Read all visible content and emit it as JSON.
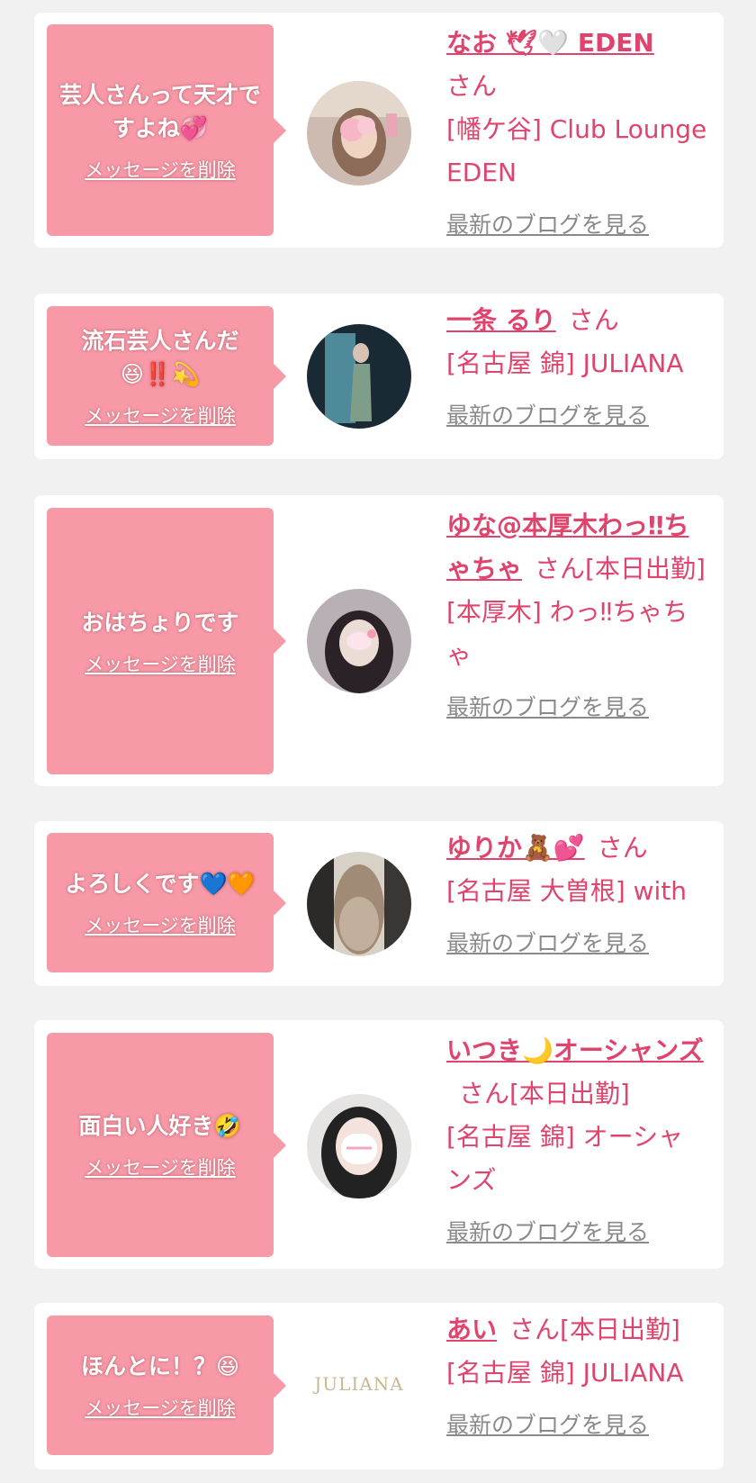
{
  "items": [
    {
      "message": "芸人さんって天才ですよね💞",
      "delete_label": "メッセージを削除",
      "name": "なお 🕊🤍 EDEN",
      "honorific": "さん",
      "shop": "[幡ケ谷] Club Lounge EDEN",
      "blog_label": "最新のブログを見る"
    },
    {
      "message": "流石芸人さんだ😆‼️💫",
      "delete_label": "メッセージを削除",
      "name": "一条 るり",
      "honorific": "さん",
      "shop": "[名古屋 錦] JULIANA",
      "blog_label": "最新のブログを見る"
    },
    {
      "message": "おはちょりです",
      "delete_label": "メッセージを削除",
      "name": "ゆな@本厚木わっ‼ちゃちゃ",
      "honorific": "さん[本日出勤]",
      "shop": "[本厚木] わっ‼ちゃちゃ",
      "blog_label": "最新のブログを見る"
    },
    {
      "message": "よろしくです💙🧡",
      "delete_label": "メッセージを削除",
      "name": "ゆりか🧸💕",
      "honorific": "さん",
      "shop": "[名古屋 大曽根] with",
      "blog_label": "最新のブログを見る"
    },
    {
      "message": "面白い人好き🤣",
      "delete_label": "メッセージを削除",
      "name": "いつき🌙オーシャンズ",
      "honorific": "さん[本日出勤]",
      "shop": "[名古屋 錦] オーシャンズ",
      "blog_label": "最新のブログを見る"
    },
    {
      "message": "ほんとに！？😆",
      "delete_label": "メッセージを削除",
      "name": "あい",
      "honorific": "さん[本日出勤]",
      "shop": "[名古屋 錦] JULIANA",
      "blog_label": "最新のブログを見る",
      "logo_text": "JULIANA"
    }
  ],
  "colors": {
    "page_bg": "#f1f1f1",
    "bubble": "#f799a7",
    "name_text": "#e0446c",
    "blog_link": "#8a8a8a"
  }
}
